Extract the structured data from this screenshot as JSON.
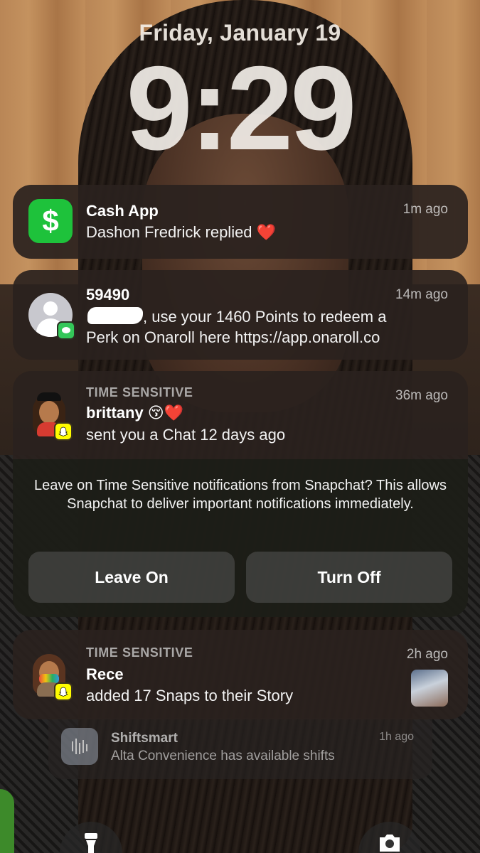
{
  "lockscreen": {
    "date": "Friday, January 19",
    "time": "9:29"
  },
  "notifications": {
    "cashapp": {
      "icon": "dollar-sign-icon",
      "icon_glyph": "$",
      "title": "Cash App",
      "ago": "1m ago",
      "body": "Dashon Fredrick replied",
      "emoji": "❤️",
      "accent": "#1ec23b"
    },
    "sms": {
      "icon": "contact-avatar-icon",
      "title": "59490",
      "ago": "14m ago",
      "line1": ", use your 1460 Points to redeem a",
      "line2": "Perk on Onaroll here https://app.onaroll.co",
      "accent": "#34c759"
    },
    "snap_brittany": {
      "icon": "bitmoji-avatar-icon",
      "label": "TIME SENSITIVE",
      "title": "brittany 😚❤️",
      "ago": "36m ago",
      "body": "sent you a Chat 12 days ago",
      "prompt": {
        "message": "Leave on Time Sensitive notifications from Snapchat? This allows Snapchat to deliver important notifications immediately.",
        "leave_on": "Leave On",
        "turn_off": "Turn Off"
      },
      "accent": "#fffc00"
    },
    "snap_rece": {
      "icon": "bitmoji-avatar-icon",
      "label": "TIME SENSITIVE",
      "title": "Rece",
      "ago": "2h ago",
      "body": "added 17 Snaps to their Story"
    },
    "shiftsmart": {
      "icon": "shiftsmart-icon",
      "title": "Shiftsmart",
      "ago": "1h ago",
      "body": "Alta Convenience has available shifts"
    }
  },
  "controls": {
    "flashlight": "flashlight-icon",
    "camera": "camera-icon"
  }
}
